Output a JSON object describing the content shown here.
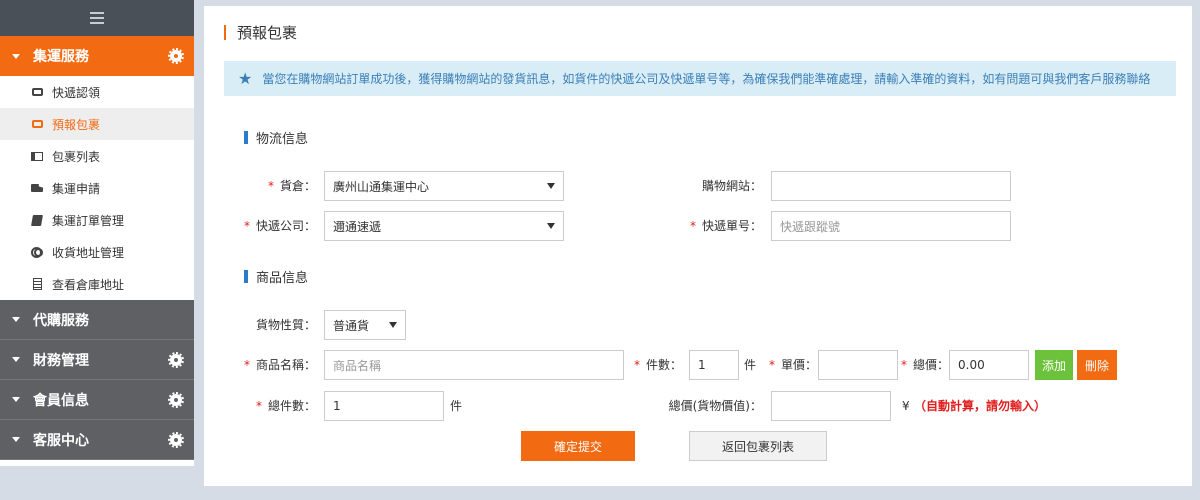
{
  "sidebar": {
    "sections": [
      {
        "label": "集運服務",
        "items": [
          {
            "label": "快遞認領"
          },
          {
            "label": "預報包裹"
          },
          {
            "label": "包裹列表"
          },
          {
            "label": "集運申請"
          },
          {
            "label": "集運訂單管理"
          },
          {
            "label": "收貨地址管理"
          },
          {
            "label": "查看倉庫地址"
          }
        ]
      },
      {
        "label": "代購服務"
      },
      {
        "label": "財務管理"
      },
      {
        "label": "會員信息"
      },
      {
        "label": "客服中心"
      }
    ]
  },
  "main": {
    "title": "預報包裹",
    "notice": "當您在購物網站訂單成功後，獲得購物網站的發貨訊息，如貨件的快遞公司及快遞單号等，為確保我們能準確處理，請輸入準確的資料，如有問題可與我們客戶服務聯絡",
    "logistics": {
      "title": "物流信息",
      "warehouse_label": "貨倉：",
      "warehouse_value": "廣州山通集運中心",
      "shop_label": "購物網站：",
      "shop_value": "",
      "courier_label": "快遞公司：",
      "courier_value": "邇通速遞",
      "tracking_label": "快遞單号：",
      "tracking_placeholder": "快遞跟蹤號"
    },
    "goods": {
      "title": "商品信息",
      "nature_label": "貨物性質：",
      "nature_value": "普通貨",
      "name_label": "商品名稱：",
      "name_placeholder": "商品名稱",
      "qty_label": "件數：",
      "qty_value": "1",
      "qty_unit": "件",
      "price_label": "單價：",
      "price_value": "",
      "total_label": "總價：",
      "total_value": "0.00",
      "add_label": "添加",
      "delete_label": "刪除",
      "total_qty_label": "總件數：",
      "total_qty_value": "1",
      "total_qty_unit": "件",
      "total_value_label": "總價(貨物價值)：",
      "total_value_value": "",
      "currency": "¥",
      "auto_note": "（自動計算，請勿輸入）"
    },
    "submit_label": "確定提交",
    "back_label": "返回包裹列表"
  },
  "colors": {
    "accent": "#f26a12",
    "sidebar_dark": "#5e6064",
    "notice_bg": "#d9edf7",
    "blue_bar": "#2a7bc9",
    "add_green": "#6cc23a"
  }
}
